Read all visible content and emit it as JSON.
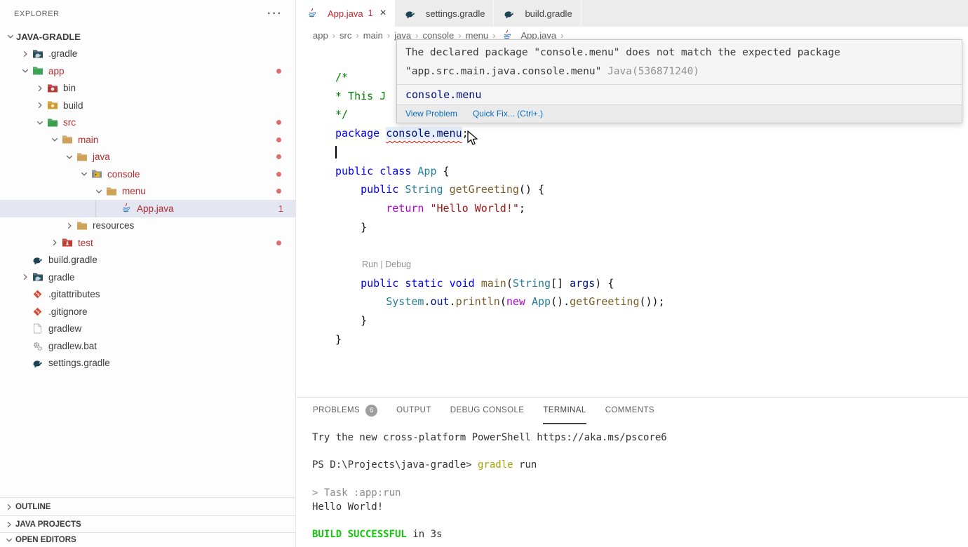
{
  "explorer": {
    "title": "EXPLORER",
    "more_label": "···",
    "root": {
      "label": "JAVA-GRADLE",
      "chevron": "expanded"
    },
    "items": [
      {
        "label": ".gradle",
        "icon": "gradle-folder-icon",
        "level": 1,
        "chevron": "collapsed"
      },
      {
        "label": "app",
        "icon": "app-folder-icon",
        "level": 1,
        "chevron": "expanded",
        "error": true,
        "dot": true
      },
      {
        "label": "bin",
        "icon": "bin-folder-icon",
        "level": 2,
        "chevron": "collapsed"
      },
      {
        "label": "build",
        "icon": "build-folder-icon",
        "level": 2,
        "chevron": "collapsed"
      },
      {
        "label": "src",
        "icon": "src-folder-icon",
        "level": 2,
        "chevron": "expanded",
        "error": true,
        "dot": true
      },
      {
        "label": "main",
        "icon": "folder-icon",
        "level": 3,
        "chevron": "expanded",
        "error": true,
        "dot": true
      },
      {
        "label": "java",
        "icon": "folder-icon",
        "level": 4,
        "chevron": "expanded",
        "error": true,
        "dot": true
      },
      {
        "label": "console",
        "icon": "console-folder-icon",
        "level": 5,
        "chevron": "expanded",
        "error": true,
        "dot": true
      },
      {
        "label": "menu",
        "icon": "folder-icon",
        "level": 6,
        "chevron": "expanded",
        "error": true,
        "dot": true
      },
      {
        "label": "App.java",
        "icon": "java-file-icon",
        "level": 7,
        "chevron": "none",
        "error": true,
        "badge": "1",
        "selected": true,
        "guide": true
      },
      {
        "label": "resources",
        "icon": "folder-icon",
        "level": 4,
        "chevron": "collapsed"
      },
      {
        "label": "test",
        "icon": "test-folder-icon",
        "level": 3,
        "chevron": "collapsed",
        "error": true,
        "dot": true
      },
      {
        "label": "build.gradle",
        "icon": "gradle-file-icon",
        "level": 1,
        "chevron": "none"
      },
      {
        "label": "gradle",
        "icon": "gradle-folder-icon",
        "level": 1,
        "chevron": "collapsed"
      },
      {
        "label": ".gitattributes",
        "icon": "git-file-icon",
        "level": 1,
        "chevron": "none"
      },
      {
        "label": ".gitignore",
        "icon": "git-file-icon",
        "level": 1,
        "chevron": "none"
      },
      {
        "label": "gradlew",
        "icon": "file-icon",
        "level": 1,
        "chevron": "none"
      },
      {
        "label": "gradlew.bat",
        "icon": "gears-file-icon",
        "level": 1,
        "chevron": "none"
      },
      {
        "label": "settings.gradle",
        "icon": "gradle-file-icon",
        "level": 1,
        "chevron": "none"
      }
    ],
    "sections": [
      {
        "label": "OUTLINE",
        "chevron": "collapsed"
      },
      {
        "label": "JAVA PROJECTS",
        "chevron": "collapsed"
      },
      {
        "label": "OPEN EDITORS",
        "chevron": "expanded"
      }
    ]
  },
  "tabs": [
    {
      "label": "App.java",
      "icon": "java-file-icon",
      "active": true,
      "error": true,
      "badge": "1",
      "close": "×"
    },
    {
      "label": "settings.gradle",
      "icon": "gradle-file-icon",
      "active": false
    },
    {
      "label": "build.gradle",
      "icon": "gradle-file-icon",
      "active": false
    }
  ],
  "breadcrumbs": {
    "separator": "›",
    "items": [
      {
        "label": "app"
      },
      {
        "label": "src"
      },
      {
        "label": "main"
      },
      {
        "label": "java"
      },
      {
        "label": "console"
      },
      {
        "label": "menu"
      },
      {
        "label": "App.java",
        "icon": "java-file-icon"
      }
    ],
    "trailing_separator": "›"
  },
  "editor": {
    "lines": [
      {
        "spans": [
          {
            "t": "/*",
            "c": "cmt"
          }
        ]
      },
      {
        "spans": [
          {
            "t": "* This J",
            "c": "cmt"
          }
        ]
      },
      {
        "spans": [
          {
            "t": "*/",
            "c": "cmt"
          }
        ]
      },
      {
        "spans": [
          {
            "t": "package",
            "c": "kw"
          },
          {
            "t": " ",
            "c": "plain"
          },
          {
            "t": "console.menu",
            "c": "pkg"
          },
          {
            "t": ";",
            "c": "plain"
          }
        ]
      },
      {
        "caret": true,
        "spans": []
      },
      {
        "spans": [
          {
            "t": "public",
            "c": "kw"
          },
          {
            "t": " ",
            "c": "plain"
          },
          {
            "t": "class",
            "c": "kw"
          },
          {
            "t": " ",
            "c": "plain"
          },
          {
            "t": "App",
            "c": "type"
          },
          {
            "t": " {",
            "c": "plain"
          }
        ]
      },
      {
        "spans": [
          {
            "t": "    ",
            "c": "plain"
          },
          {
            "t": "public",
            "c": "kw"
          },
          {
            "t": " ",
            "c": "plain"
          },
          {
            "t": "String",
            "c": "type"
          },
          {
            "t": " ",
            "c": "plain"
          },
          {
            "t": "getGreeting",
            "c": "fn"
          },
          {
            "t": "() {",
            "c": "plain"
          }
        ]
      },
      {
        "spans": [
          {
            "t": "        ",
            "c": "plain"
          },
          {
            "t": "return",
            "c": "ctrl"
          },
          {
            "t": " ",
            "c": "plain"
          },
          {
            "t": "\"Hello World!\"",
            "c": "str"
          },
          {
            "t": ";",
            "c": "plain"
          }
        ]
      },
      {
        "spans": [
          {
            "t": "    }",
            "c": "plain"
          }
        ]
      },
      {
        "spans": []
      },
      {
        "codelens": true
      },
      {
        "spans": [
          {
            "t": "    ",
            "c": "plain"
          },
          {
            "t": "public",
            "c": "kw"
          },
          {
            "t": " ",
            "c": "plain"
          },
          {
            "t": "static",
            "c": "kw"
          },
          {
            "t": " ",
            "c": "plain"
          },
          {
            "t": "void",
            "c": "kw"
          },
          {
            "t": " ",
            "c": "plain"
          },
          {
            "t": "main",
            "c": "fn"
          },
          {
            "t": "(",
            "c": "plain"
          },
          {
            "t": "String",
            "c": "type"
          },
          {
            "t": "[] ",
            "c": "plain"
          },
          {
            "t": "args",
            "c": "var"
          },
          {
            "t": ") {",
            "c": "plain"
          }
        ]
      },
      {
        "spans": [
          {
            "t": "        ",
            "c": "plain"
          },
          {
            "t": "System",
            "c": "type"
          },
          {
            "t": ".",
            "c": "plain"
          },
          {
            "t": "out",
            "c": "var"
          },
          {
            "t": ".",
            "c": "plain"
          },
          {
            "t": "println",
            "c": "fn"
          },
          {
            "t": "(",
            "c": "plain"
          },
          {
            "t": "new",
            "c": "ctrl"
          },
          {
            "t": " ",
            "c": "plain"
          },
          {
            "t": "App",
            "c": "type"
          },
          {
            "t": "().",
            "c": "plain"
          },
          {
            "t": "getGreeting",
            "c": "fn"
          },
          {
            "t": "());",
            "c": "plain"
          }
        ]
      },
      {
        "spans": [
          {
            "t": "    }",
            "c": "plain"
          }
        ]
      },
      {
        "spans": [
          {
            "t": "}",
            "c": "plain"
          }
        ]
      }
    ],
    "codelens": {
      "run_label": "Run",
      "divider": "|",
      "debug_label": "Debug"
    }
  },
  "hover_popup": {
    "message_line1": "The declared package \"console.menu\" does not match the expected package",
    "message_line2": "\"app.src.main.java.console.menu\"",
    "code_ref": "Java(536871240)",
    "related": "console.menu",
    "actions": [
      {
        "label": "View Problem"
      },
      {
        "label": "Quick Fix... (Ctrl+.)"
      }
    ]
  },
  "panel": {
    "tabs": [
      {
        "label": "PROBLEMS",
        "badge": "6"
      },
      {
        "label": "OUTPUT"
      },
      {
        "label": "DEBUG CONSOLE"
      },
      {
        "label": "TERMINAL",
        "active": true
      },
      {
        "label": "COMMENTS"
      }
    ],
    "terminal_lines": [
      [
        {
          "t": "Try the new cross-platform PowerShell https://aka.ms/pscore6"
        }
      ],
      [],
      [
        {
          "t": "PS D:\\Projects\\java-gradle> "
        },
        {
          "t": "gradle",
          "c": "t-yellow"
        },
        {
          "t": " run"
        }
      ],
      [],
      [
        {
          "t": "> Task :app:run",
          "c": "t-gray"
        }
      ],
      [
        {
          "t": "Hello World!"
        }
      ],
      [],
      [
        {
          "t": "BUILD SUCCESSFUL",
          "c": "t-green"
        },
        {
          "t": " in 3s"
        }
      ]
    ]
  },
  "colors": {
    "error_label": "#b32b2f",
    "error_dot": "#d9706c",
    "selected_row_bg": "#e4e6f1",
    "tab_error_text": "#c0262d",
    "link_blue": "#0a6cbe",
    "terminal_green": "#16c60c",
    "terminal_yellow": "#a8a400",
    "keyword_blue": "#0000ff",
    "type_teal": "#267f99",
    "string_red": "#a31515",
    "comment_green": "#008000"
  }
}
